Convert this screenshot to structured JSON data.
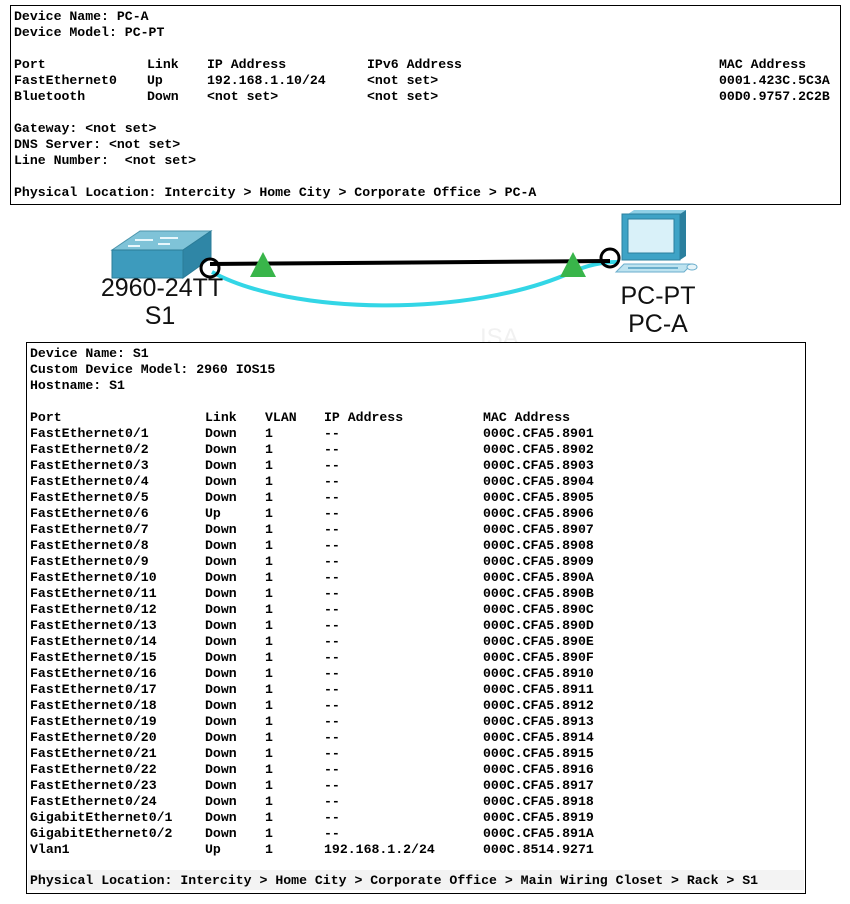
{
  "pc_panel": {
    "device_name": "Device Name: PC-A",
    "device_model": "Device Model: PC-PT",
    "headers": {
      "port": "Port",
      "link": "Link",
      "ip": "IP Address",
      "ipv6": "IPv6 Address",
      "mac": "MAC Address"
    },
    "ports": [
      {
        "port": "FastEthernet0",
        "link": "Up",
        "ip": "192.168.1.10/24",
        "ipv6": "<not set>",
        "mac": "0001.423C.5C3A"
      },
      {
        "port": "Bluetooth",
        "link": "Down",
        "ip": "<not set>",
        "ipv6": "<not set>",
        "mac": "00D0.9757.2C2B"
      }
    ],
    "gateway": "Gateway: <not set>",
    "dns": "DNS Server: <not set>",
    "line_number": "Line Number:  <not set>",
    "location": "Physical Location: Intercity > Home City > Corporate Office > PC-A"
  },
  "topology": {
    "switch_model": "2960-24TT",
    "switch_name": "S1",
    "pc_model": "PC-PT",
    "pc_name": "PC-A",
    "link_status_color": "#39b54a",
    "cable_color": "#33d6e6"
  },
  "s1_panel": {
    "device_name": "Device Name: S1",
    "custom_model": "Custom Device Model: 2960 IOS15",
    "hostname": "Hostname: S1",
    "headers": {
      "port": "Port",
      "link": "Link",
      "vlan": "VLAN",
      "ip": "IP Address",
      "mac": "MAC Address"
    },
    "ports": [
      {
        "port": "FastEthernet0/1",
        "link": "Down",
        "vlan": "1",
        "ip": "--",
        "mac": "000C.CFA5.8901"
      },
      {
        "port": "FastEthernet0/2",
        "link": "Down",
        "vlan": "1",
        "ip": "--",
        "mac": "000C.CFA5.8902"
      },
      {
        "port": "FastEthernet0/3",
        "link": "Down",
        "vlan": "1",
        "ip": "--",
        "mac": "000C.CFA5.8903"
      },
      {
        "port": "FastEthernet0/4",
        "link": "Down",
        "vlan": "1",
        "ip": "--",
        "mac": "000C.CFA5.8904"
      },
      {
        "port": "FastEthernet0/5",
        "link": "Down",
        "vlan": "1",
        "ip": "--",
        "mac": "000C.CFA5.8905"
      },
      {
        "port": "FastEthernet0/6",
        "link": "Up",
        "vlan": "1",
        "ip": "--",
        "mac": "000C.CFA5.8906"
      },
      {
        "port": "FastEthernet0/7",
        "link": "Down",
        "vlan": "1",
        "ip": "--",
        "mac": "000C.CFA5.8907"
      },
      {
        "port": "FastEthernet0/8",
        "link": "Down",
        "vlan": "1",
        "ip": "--",
        "mac": "000C.CFA5.8908"
      },
      {
        "port": "FastEthernet0/9",
        "link": "Down",
        "vlan": "1",
        "ip": "--",
        "mac": "000C.CFA5.8909"
      },
      {
        "port": "FastEthernet0/10",
        "link": "Down",
        "vlan": "1",
        "ip": "--",
        "mac": "000C.CFA5.890A"
      },
      {
        "port": "FastEthernet0/11",
        "link": "Down",
        "vlan": "1",
        "ip": "--",
        "mac": "000C.CFA5.890B"
      },
      {
        "port": "FastEthernet0/12",
        "link": "Down",
        "vlan": "1",
        "ip": "--",
        "mac": "000C.CFA5.890C"
      },
      {
        "port": "FastEthernet0/13",
        "link": "Down",
        "vlan": "1",
        "ip": "--",
        "mac": "000C.CFA5.890D"
      },
      {
        "port": "FastEthernet0/14",
        "link": "Down",
        "vlan": "1",
        "ip": "--",
        "mac": "000C.CFA5.890E"
      },
      {
        "port": "FastEthernet0/15",
        "link": "Down",
        "vlan": "1",
        "ip": "--",
        "mac": "000C.CFA5.890F"
      },
      {
        "port": "FastEthernet0/16",
        "link": "Down",
        "vlan": "1",
        "ip": "--",
        "mac": "000C.CFA5.8910"
      },
      {
        "port": "FastEthernet0/17",
        "link": "Down",
        "vlan": "1",
        "ip": "--",
        "mac": "000C.CFA5.8911"
      },
      {
        "port": "FastEthernet0/18",
        "link": "Down",
        "vlan": "1",
        "ip": "--",
        "mac": "000C.CFA5.8912"
      },
      {
        "port": "FastEthernet0/19",
        "link": "Down",
        "vlan": "1",
        "ip": "--",
        "mac": "000C.CFA5.8913"
      },
      {
        "port": "FastEthernet0/20",
        "link": "Down",
        "vlan": "1",
        "ip": "--",
        "mac": "000C.CFA5.8914"
      },
      {
        "port": "FastEthernet0/21",
        "link": "Down",
        "vlan": "1",
        "ip": "--",
        "mac": "000C.CFA5.8915"
      },
      {
        "port": "FastEthernet0/22",
        "link": "Down",
        "vlan": "1",
        "ip": "--",
        "mac": "000C.CFA5.8916"
      },
      {
        "port": "FastEthernet0/23",
        "link": "Down",
        "vlan": "1",
        "ip": "--",
        "mac": "000C.CFA5.8917"
      },
      {
        "port": "FastEthernet0/24",
        "link": "Down",
        "vlan": "1",
        "ip": "--",
        "mac": "000C.CFA5.8918"
      },
      {
        "port": "GigabitEthernet0/1",
        "link": "Down",
        "vlan": "1",
        "ip": "--",
        "mac": "000C.CFA5.8919"
      },
      {
        "port": "GigabitEthernet0/2",
        "link": "Down",
        "vlan": "1",
        "ip": "--",
        "mac": "000C.CFA5.891A"
      },
      {
        "port": "Vlan1",
        "link": "Up",
        "vlan": "1",
        "ip": "192.168.1.2/24",
        "mac": "000C.8514.9271"
      }
    ],
    "location": "Physical Location: Intercity > Home City > Corporate Office > Main Wiring Closet > Rack > S1"
  }
}
